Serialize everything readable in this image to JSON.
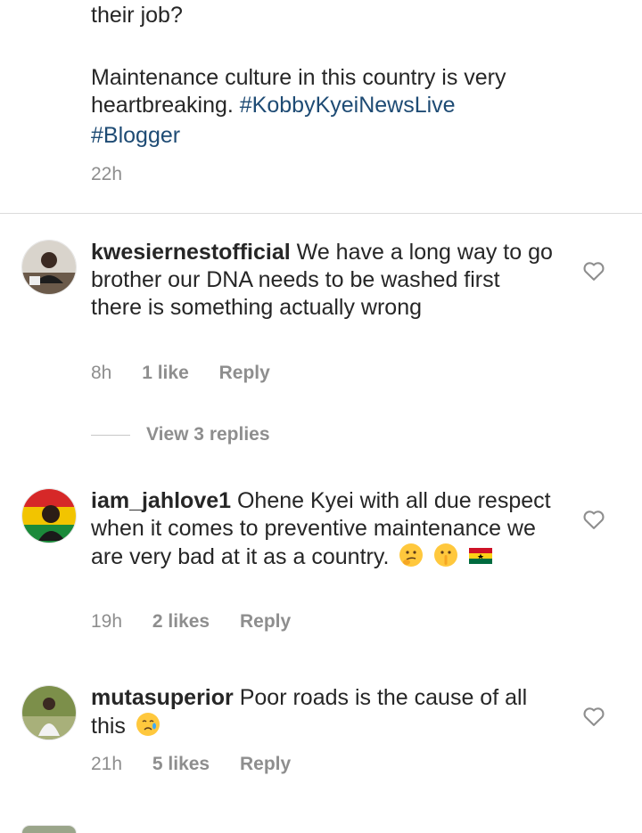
{
  "post_caption": {
    "line1": "their job?",
    "line2": "Maintenance culture in this country is very",
    "line3_text": "heartbreaking.",
    "hashtag1": "#KobbyKyeiNewsLive",
    "hashtag2": "#Blogger",
    "time": "22h"
  },
  "comments": [
    {
      "username": "kwesiernestofficial",
      "text": "We have a long way to go brother  our DNA needs to be washed first there is something actually wrong",
      "time": "8h",
      "likes": "1 like",
      "reply": "Reply"
    },
    {
      "username": "iam_jahlove1",
      "text": "Ohene Kyei with all due respect when it comes to preventive maintenance we are very bad at it as a country.",
      "emojis": [
        "thinking-face",
        "shushing-face",
        "ghana-flag"
      ],
      "time": "19h",
      "likes": "2 likes",
      "reply": "Reply"
    },
    {
      "username": "mutasuperior",
      "text": "Poor roads is the cause of all this",
      "emojis": [
        "crying-face"
      ],
      "time": "21h",
      "likes": "5 likes",
      "reply": "Reply"
    }
  ],
  "view_replies": "View 3 replies",
  "colors": {
    "hashtag": "#1e4b74",
    "meta": "#8e8e8e",
    "text": "#262626"
  }
}
